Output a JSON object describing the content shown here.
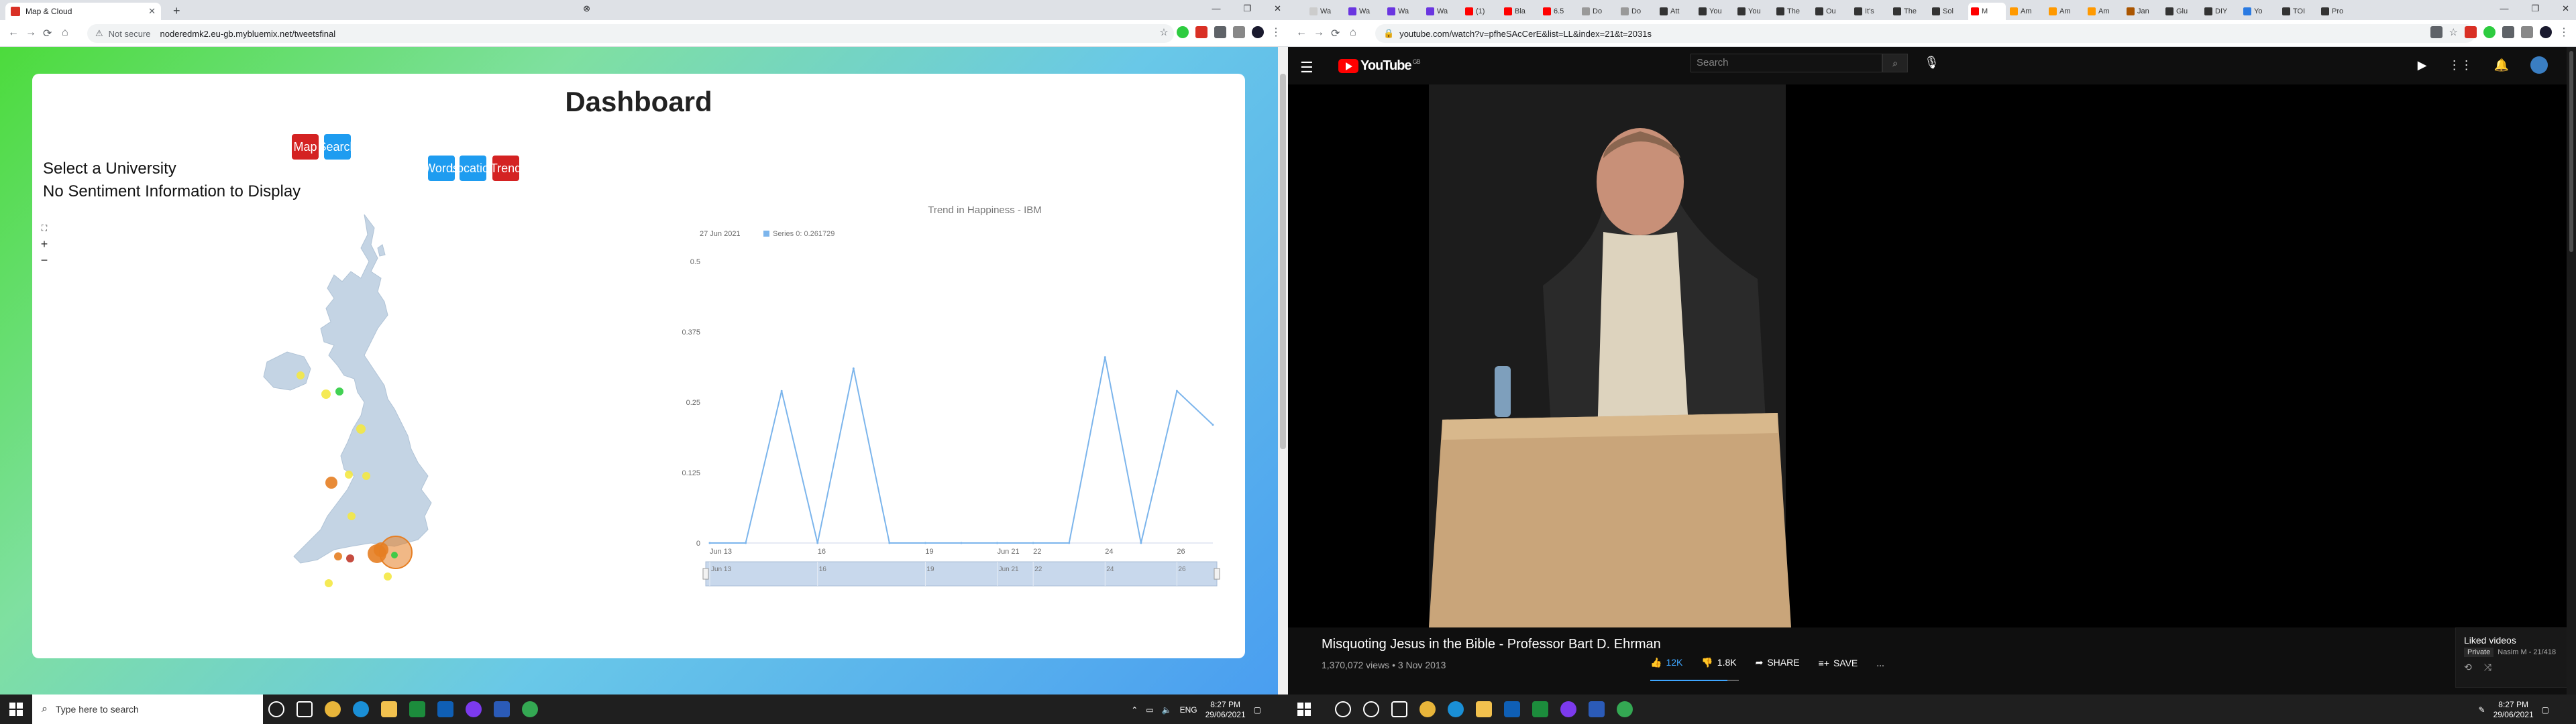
{
  "left": {
    "tab": {
      "title": "Map & Cloud",
      "favicon_color": "#d93025"
    },
    "url": {
      "security": "Not secure",
      "address": "noderedmk2.eu-gb.mybluemix.net/tweetsfinal"
    },
    "dashboard": {
      "title": "Dashboard",
      "nav_buttons": [
        {
          "label": "Map"
        },
        {
          "label": "Search"
        }
      ],
      "view_buttons": [
        {
          "label": "Words"
        },
        {
          "label": "Location"
        },
        {
          "label": "Trend"
        }
      ],
      "select_label": "Select a University",
      "sentiment_message": "No Sentiment Information to Display",
      "map_controls": {
        "fullscreen": "⛶",
        "zoom_in": "+",
        "zoom_out": "−"
      }
    }
  },
  "right": {
    "tabs": [
      {
        "label": "Wa",
        "color": "#cccccc"
      },
      {
        "label": "Wa",
        "color": "#6a35e0"
      },
      {
        "label": "Wa",
        "color": "#6a35e0"
      },
      {
        "label": "Wa",
        "color": "#6a35e0"
      },
      {
        "label": "(1)",
        "color": "#ff0000"
      },
      {
        "label": "Bla",
        "color": "#ff0000"
      },
      {
        "label": "6.5",
        "color": "#ff0000"
      },
      {
        "label": "Do",
        "color": "#999999"
      },
      {
        "label": "Do",
        "color": "#999999"
      },
      {
        "label": "Att",
        "color": "#333333"
      },
      {
        "label": "You",
        "color": "#333333"
      },
      {
        "label": "You",
        "color": "#333333"
      },
      {
        "label": "The",
        "color": "#333333"
      },
      {
        "label": "Ou",
        "color": "#333333"
      },
      {
        "label": "It's",
        "color": "#333333"
      },
      {
        "label": "The",
        "color": "#333333"
      },
      {
        "label": "Sol",
        "color": "#333333"
      },
      {
        "label": "M",
        "color": "#ff0000"
      },
      {
        "label": "Am",
        "color": "#ff9900"
      },
      {
        "label": "Am",
        "color": "#ff9900"
      },
      {
        "label": "Am",
        "color": "#ff9900"
      },
      {
        "label": "Jan",
        "color": "#aa5500"
      },
      {
        "label": "Glu",
        "color": "#333333"
      },
      {
        "label": "DIY",
        "color": "#333333"
      },
      {
        "label": "Yo",
        "color": "#2a7ae2"
      },
      {
        "label": "TOI",
        "color": "#333333"
      },
      {
        "label": "Pro",
        "color": "#333333"
      }
    ],
    "url": {
      "address": "youtube.com/watch?v=pfheSAcCerE&list=LL&index=21&t=2031s"
    },
    "youtube": {
      "logo": "YouTube",
      "country": "GB",
      "search_placeholder": "Search",
      "video_title": "Misquoting Jesus in the Bible - Professor Bart D. Ehrman",
      "meta": "1,370,072 views • 3 Nov 2013",
      "likes": "12K",
      "dislikes": "1.8K",
      "share": "SHARE",
      "save": "SAVE",
      "more": "...",
      "like_ratio": 0.87,
      "playlist": {
        "title": "Liked videos",
        "privacy": "Private",
        "owner": "Nasim M - 21/418"
      }
    }
  },
  "taskbar": {
    "search_placeholder": "Type here to search",
    "language": "ENG",
    "time": "8:27 PM",
    "date": "29/06/2021"
  },
  "chart_data": {
    "type": "line",
    "title": "Trend in Happiness - IBM",
    "tooltip": {
      "date": "27 Jun 2021",
      "text": "Series 0: 0.261729"
    },
    "x": [
      "Jun 13",
      "Jun 14",
      "Jun 15",
      "Jun 16",
      "Jun 17",
      "Jun 18",
      "Jun 19",
      "Jun 20",
      "Jun 21",
      "Jun 22",
      "Jun 23",
      "Jun 24",
      "Jun 25",
      "Jun 26",
      "Jun 27"
    ],
    "series": [
      {
        "values": [
          0,
          0,
          0.27,
          0,
          0.31,
          0,
          0,
          0,
          0,
          0,
          0,
          0.33,
          0,
          0.27,
          0.21
        ],
        "color": "#7cb5ec"
      }
    ],
    "x_tick_labels": [
      "Jun 13",
      "16",
      "19",
      "Jun 21",
      "22",
      "24",
      "26"
    ],
    "navigator_tick_labels": [
      "Jun 13",
      "16",
      "19",
      "Jun 21",
      "22",
      "24",
      "26"
    ],
    "y_ticks": [
      "0",
      "0.125",
      "0.25",
      "0.375",
      "0.5"
    ],
    "ylim": [
      0,
      0.5
    ]
  },
  "map_data": {
    "markers": [
      {
        "name": "north-west",
        "color": "#f4e842",
        "size": 6
      },
      {
        "name": "scotland-a",
        "color": "#f4e842",
        "size": 7
      },
      {
        "name": "scotland-b",
        "color": "#2ecc40",
        "size": 6
      },
      {
        "name": "northern-england",
        "color": "#f4e842",
        "size": 7
      },
      {
        "name": "midlands-a",
        "color": "#f4e842",
        "size": 6
      },
      {
        "name": "midlands-b",
        "color": "#e67e22",
        "size": 9
      },
      {
        "name": "midlands-c",
        "color": "#f4e842",
        "size": 6
      },
      {
        "name": "wales-a",
        "color": "#f4e842",
        "size": 6
      },
      {
        "name": "london-ring",
        "color": "#e67e22",
        "size": 24
      },
      {
        "name": "london-inner",
        "color": "#e67e22",
        "size": 14
      },
      {
        "name": "oxford",
        "color": "#e67e22",
        "size": 11
      },
      {
        "name": "london-centre",
        "color": "#2ecc40",
        "size": 5
      },
      {
        "name": "bristol-a",
        "color": "#e67e22",
        "size": 6
      },
      {
        "name": "bristol-b",
        "color": "#c0392b",
        "size": 6
      },
      {
        "name": "south-west",
        "color": "#f4e842",
        "size": 6
      },
      {
        "name": "south-coast",
        "color": "#f4e842",
        "size": 6
      }
    ]
  }
}
